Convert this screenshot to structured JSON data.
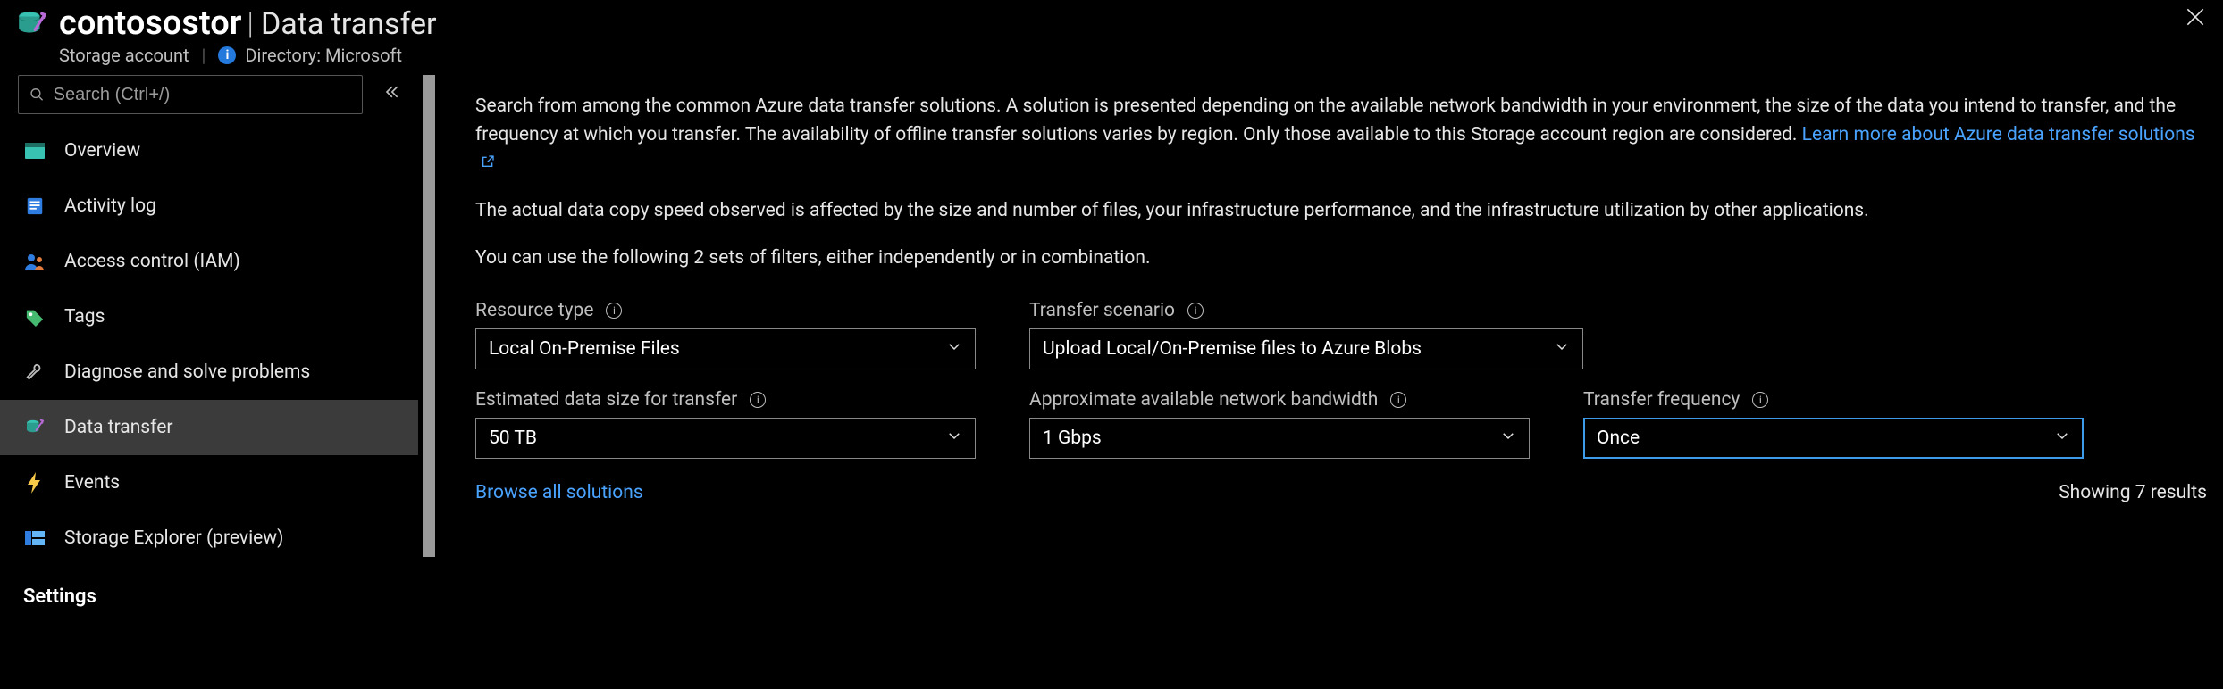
{
  "header": {
    "resource_name": "contosostor",
    "blade_title": "Data transfer",
    "resource_type": "Storage account",
    "directory_label": "Directory: Microsoft"
  },
  "search": {
    "placeholder": "Search (Ctrl+/)"
  },
  "nav": {
    "items": [
      {
        "label": "Overview"
      },
      {
        "label": "Activity log"
      },
      {
        "label": "Access control (IAM)"
      },
      {
        "label": "Tags"
      },
      {
        "label": "Diagnose and solve problems"
      },
      {
        "label": "Data transfer"
      },
      {
        "label": "Events"
      },
      {
        "label": "Storage Explorer (preview)"
      }
    ],
    "section_settings": "Settings"
  },
  "content": {
    "p1": "Search from among the common Azure data transfer solutions. A solution is presented depending on the available network bandwidth in your environment, the size of the data you intend to transfer, and the frequency at which you transfer. The availability of offline transfer solutions varies by region. Only those available to this Storage account region are considered. ",
    "learn_more": "Learn more about Azure data transfer solutions",
    "p2": "The actual data copy speed observed is affected by the size and number of files, your infrastructure performance, and the infrastructure utilization by other applications.",
    "p3": "You can use the following 2 sets of filters, either independently or in combination.",
    "browse_all": "Browse all solutions",
    "results_text": "Showing 7 results"
  },
  "filters": {
    "resource_type": {
      "label": "Resource type",
      "value": "Local On-Premise Files"
    },
    "scenario": {
      "label": "Transfer scenario",
      "value": "Upload Local/On-Premise files to Azure Blobs"
    },
    "data_size": {
      "label": "Estimated data size for transfer",
      "value": "50 TB"
    },
    "bandwidth": {
      "label": "Approximate available network bandwidth",
      "value": "1 Gbps"
    },
    "frequency": {
      "label": "Transfer frequency",
      "value": "Once"
    }
  }
}
